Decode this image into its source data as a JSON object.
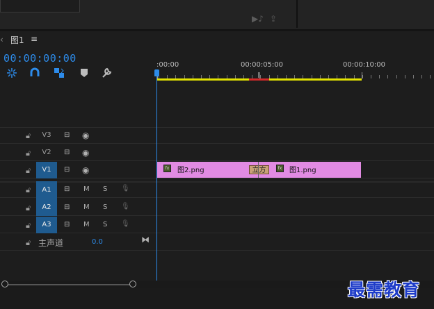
{
  "sequence": {
    "tab_label": "图1"
  },
  "timecode": "00:00:00:00",
  "ruler": {
    "labels": [
      ":00:00",
      "00:00:05:00",
      "00:00:10:00"
    ]
  },
  "tracks": {
    "video": [
      {
        "name": "V3",
        "targeted": false
      },
      {
        "name": "V2",
        "targeted": false
      },
      {
        "name": "V1",
        "targeted": true
      }
    ],
    "audio": [
      {
        "name": "A1",
        "targeted": true,
        "mute": "M",
        "solo": "S"
      },
      {
        "name": "A2",
        "targeted": true,
        "mute": "M",
        "solo": "S"
      },
      {
        "name": "A3",
        "targeted": true,
        "mute": "M",
        "solo": "S"
      }
    ],
    "master": {
      "name": "主声道",
      "volume": "0.0"
    }
  },
  "clips": [
    {
      "name": "图2.png"
    },
    {
      "name": "图1.png"
    }
  ],
  "transition": {
    "label": "立方"
  },
  "watermark": "最需教育",
  "colors": {
    "accent": "#2d8ceb",
    "clip": "#e28be3",
    "work_area": "#e4e400",
    "track_target": "#1f5b8f"
  }
}
